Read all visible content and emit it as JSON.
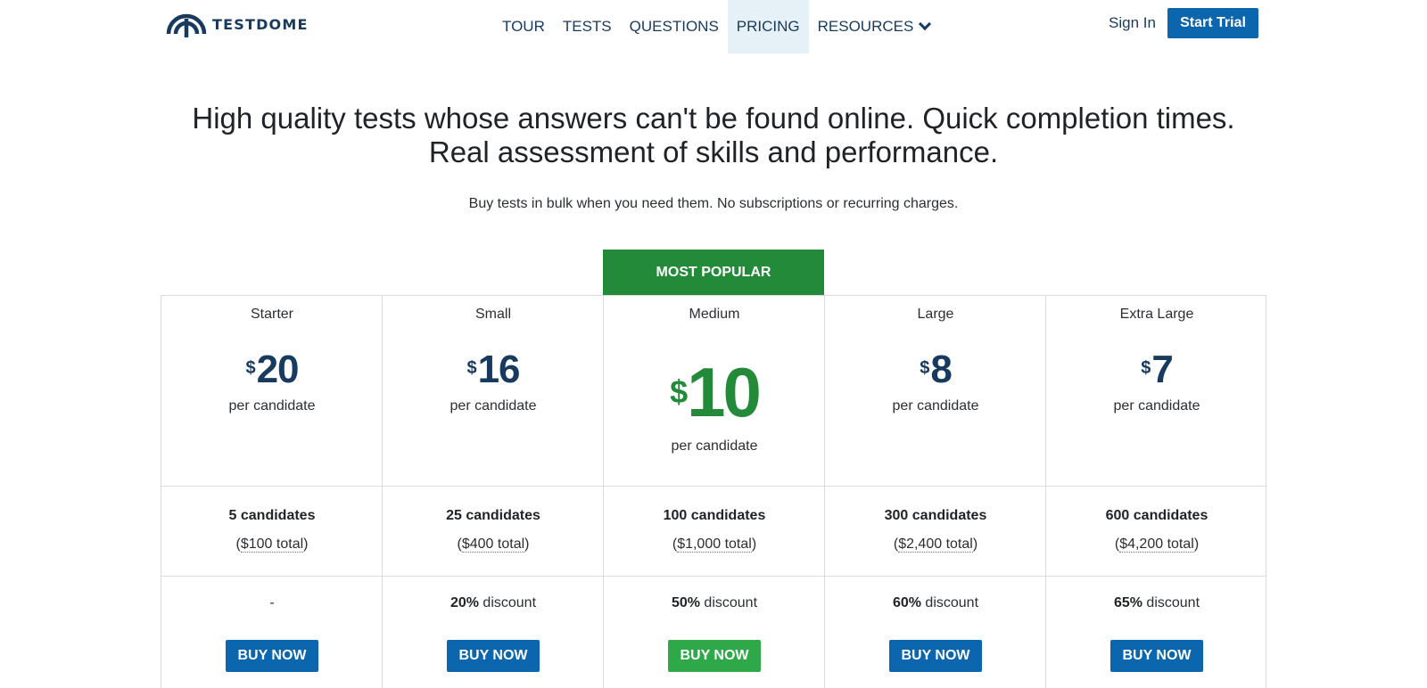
{
  "brand": {
    "name": "TESTDOME",
    "color": "#173a5e"
  },
  "nav": {
    "items": [
      {
        "label": "TOUR"
      },
      {
        "label": "TESTS"
      },
      {
        "label": "QUESTIONS"
      },
      {
        "label": "PRICING",
        "active": true
      },
      {
        "label": "RESOURCES"
      }
    ],
    "sign_in": "Sign In",
    "start_trial": "Start Trial"
  },
  "hero": {
    "headline": "High quality tests whose answers can't be found online. Quick completion times. Real assessment of skills and performance.",
    "subline": "Buy tests in bulk when you need them. No subscriptions or recurring charges."
  },
  "pricing": {
    "badge": "MOST POPULAR",
    "currency": "$",
    "per_label": "per candidate",
    "buy_label": "BUY NOW",
    "tiers": [
      {
        "name": "Starter",
        "price": "20",
        "candidates": "5 candidates",
        "total": "$100 total",
        "discount_pct": "",
        "discount_text": "-"
      },
      {
        "name": "Small",
        "price": "16",
        "candidates": "25 candidates",
        "total": "$400 total",
        "discount_pct": "20%",
        "discount_text": " discount"
      },
      {
        "name": "Medium",
        "price": "10",
        "candidates": "100 candidates",
        "total": "$1,000 total",
        "discount_pct": "50%",
        "discount_text": " discount",
        "featured": true
      },
      {
        "name": "Large",
        "price": "8",
        "candidates": "300 candidates",
        "total": "$2,400 total",
        "discount_pct": "60%",
        "discount_text": " discount"
      },
      {
        "name": "Extra Large",
        "price": "7",
        "candidates": "600 candidates",
        "total": "$4,200 total",
        "discount_pct": "65%",
        "discount_text": " discount"
      }
    ]
  },
  "colors": {
    "primary": "#0b66ad",
    "featured": "#238a3a",
    "featured_button": "#2fa84a",
    "nav_active_bg": "#e6f0f7"
  }
}
